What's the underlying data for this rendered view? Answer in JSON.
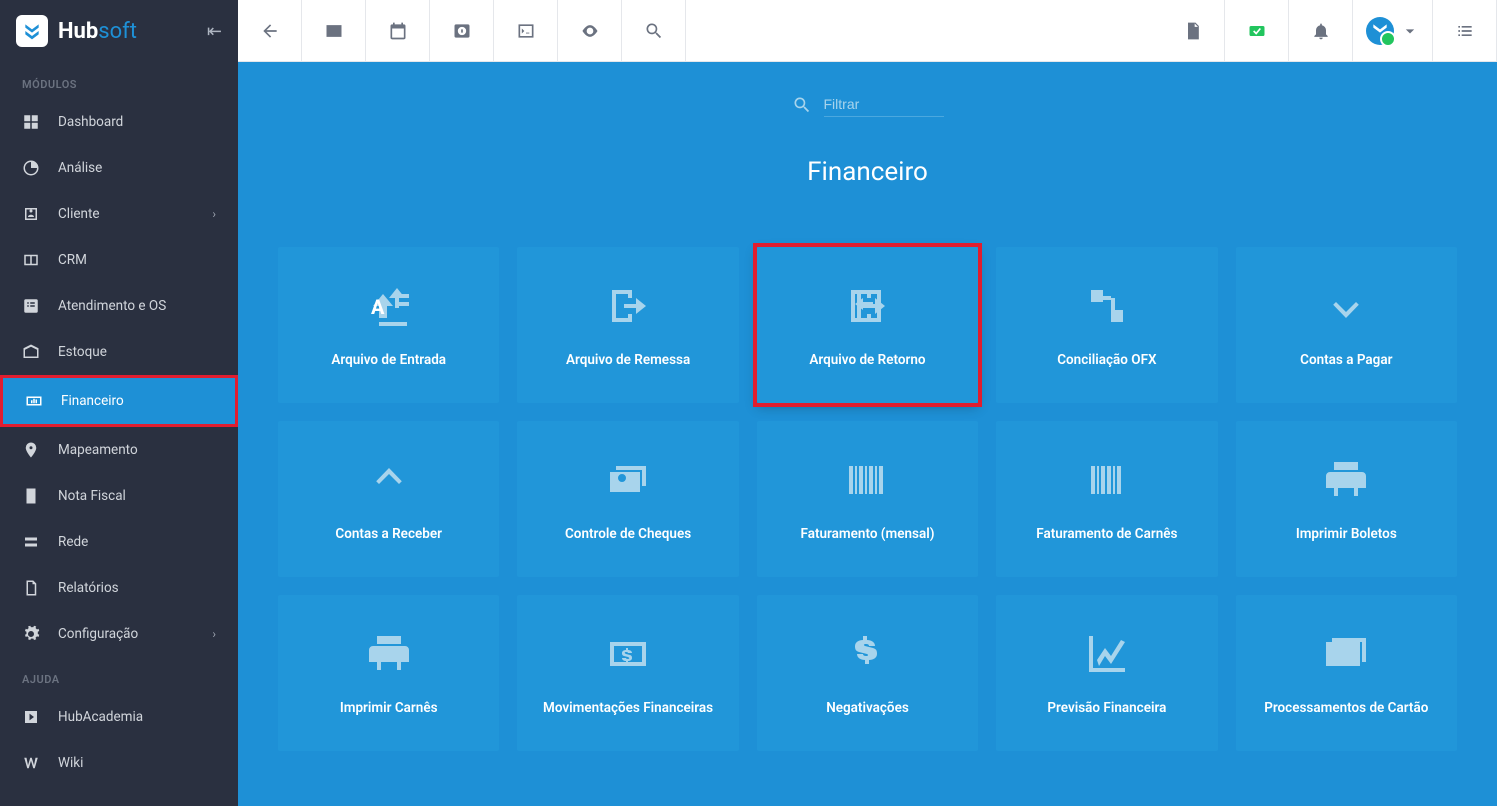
{
  "logo": {
    "brand1": "Hub",
    "brand2": "soft"
  },
  "sidebar": {
    "section_modules": "MÓDULOS",
    "section_help": "AJUDA",
    "items": [
      {
        "label": "Dashboard",
        "icon": "dashboard"
      },
      {
        "label": "Análise",
        "icon": "analytics"
      },
      {
        "label": "Cliente",
        "icon": "client",
        "expandable": true
      },
      {
        "label": "CRM",
        "icon": "crm"
      },
      {
        "label": "Atendimento e OS",
        "icon": "support"
      },
      {
        "label": "Estoque",
        "icon": "inventory"
      },
      {
        "label": "Financeiro",
        "icon": "finance",
        "active": true,
        "highlighted": true
      },
      {
        "label": "Mapeamento",
        "icon": "map"
      },
      {
        "label": "Nota Fiscal",
        "icon": "invoice"
      },
      {
        "label": "Rede",
        "icon": "network"
      },
      {
        "label": "Relatórios",
        "icon": "reports"
      },
      {
        "label": "Configuração",
        "icon": "settings",
        "expandable": true
      }
    ],
    "help_items": [
      {
        "label": "HubAcademia",
        "icon": "academy"
      },
      {
        "label": "Wiki",
        "icon": "wiki"
      }
    ]
  },
  "content": {
    "filter_placeholder": "Filtrar",
    "page_title": "Financeiro",
    "tiles": [
      {
        "label": "Arquivo de Entrada",
        "icon": "file-up"
      },
      {
        "label": "Arquivo de Remessa",
        "icon": "exit"
      },
      {
        "label": "Arquivo de Retorno",
        "icon": "enter",
        "highlighted": true
      },
      {
        "label": "Conciliação OFX",
        "icon": "reconcile"
      },
      {
        "label": "Contas a Pagar",
        "icon": "arrow-down"
      },
      {
        "label": "Contas a Receber",
        "icon": "arrow-up"
      },
      {
        "label": "Controle de Cheques",
        "icon": "checks"
      },
      {
        "label": "Faturamento (mensal)",
        "icon": "barcode"
      },
      {
        "label": "Faturamento de Carnês",
        "icon": "barcode2"
      },
      {
        "label": "Imprimir Boletos",
        "icon": "print"
      },
      {
        "label": "Imprimir Carnês",
        "icon": "print2"
      },
      {
        "label": "Movimentações Financeiras",
        "icon": "money-move"
      },
      {
        "label": "Negativações",
        "icon": "dollar"
      },
      {
        "label": "Previsão Financeira",
        "icon": "chart"
      },
      {
        "label": "Processamentos de Cartão",
        "icon": "card"
      }
    ]
  }
}
